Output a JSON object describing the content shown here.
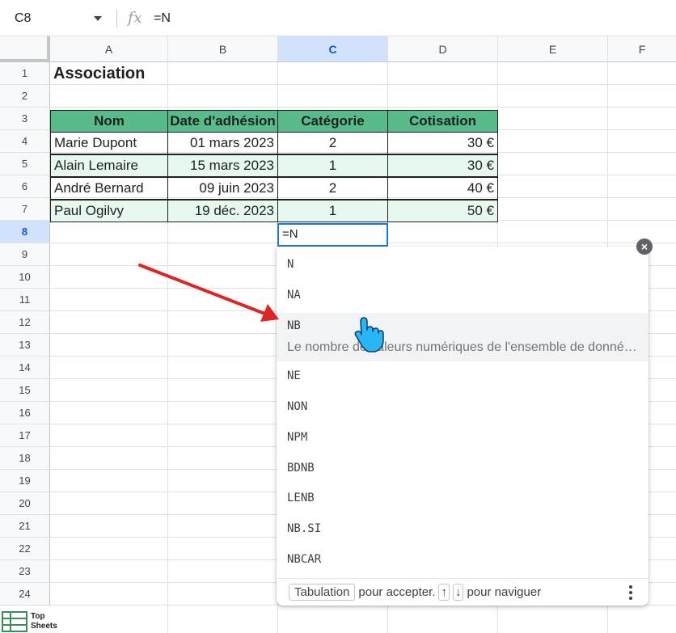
{
  "formula_bar": {
    "name_box": "C8",
    "fx_symbol": "fx",
    "value": "=N"
  },
  "columns": [
    "A",
    "B",
    "C",
    "D",
    "E",
    "F"
  ],
  "rows": [
    "1",
    "2",
    "3",
    "4",
    "5",
    "6",
    "7",
    "8",
    "9",
    "10",
    "11",
    "12",
    "13",
    "14",
    "15",
    "16",
    "17",
    "18",
    "19",
    "20",
    "21",
    "22",
    "23",
    "24"
  ],
  "sheet": {
    "title": "Association",
    "headers": [
      "Nom",
      "Date d'adhésion",
      "Catégorie",
      "Cotisation"
    ],
    "data": [
      [
        "Marie Dupont",
        "01 mars 2023",
        "2",
        "30 €"
      ],
      [
        "Alain Lemaire",
        "15 mars 2023",
        "1",
        "30 €"
      ],
      [
        "André Bernard",
        "09 juin 2023",
        "2",
        "40 €"
      ],
      [
        "Paul Ogilvy",
        "19 déc. 2023",
        "1",
        "50 €"
      ]
    ],
    "active_cell_value": "=N"
  },
  "autocomplete": {
    "suggestions": [
      "N",
      "NA",
      "NB",
      "NE",
      "NON",
      "NPM",
      "BDNB",
      "LENB",
      "NB.SI",
      "NBCAR"
    ],
    "highlighted_description": "Le nombre de valeurs numériques de l'ensemble de donné…",
    "footer": {
      "key_tab": "Tabulation",
      "accept_text": "pour accepter.",
      "key_up": "↑",
      "key_down": "↓",
      "navigate_text": "pour naviguer"
    },
    "close_symbol": "×"
  },
  "logo": {
    "line1": "Top",
    "line2": "Sheets"
  },
  "colors": {
    "header_green": "#57bb8a",
    "alt_row": "#e7f9ef",
    "selection_blue": "#1a73e8",
    "arrow_red": "#e02424"
  }
}
